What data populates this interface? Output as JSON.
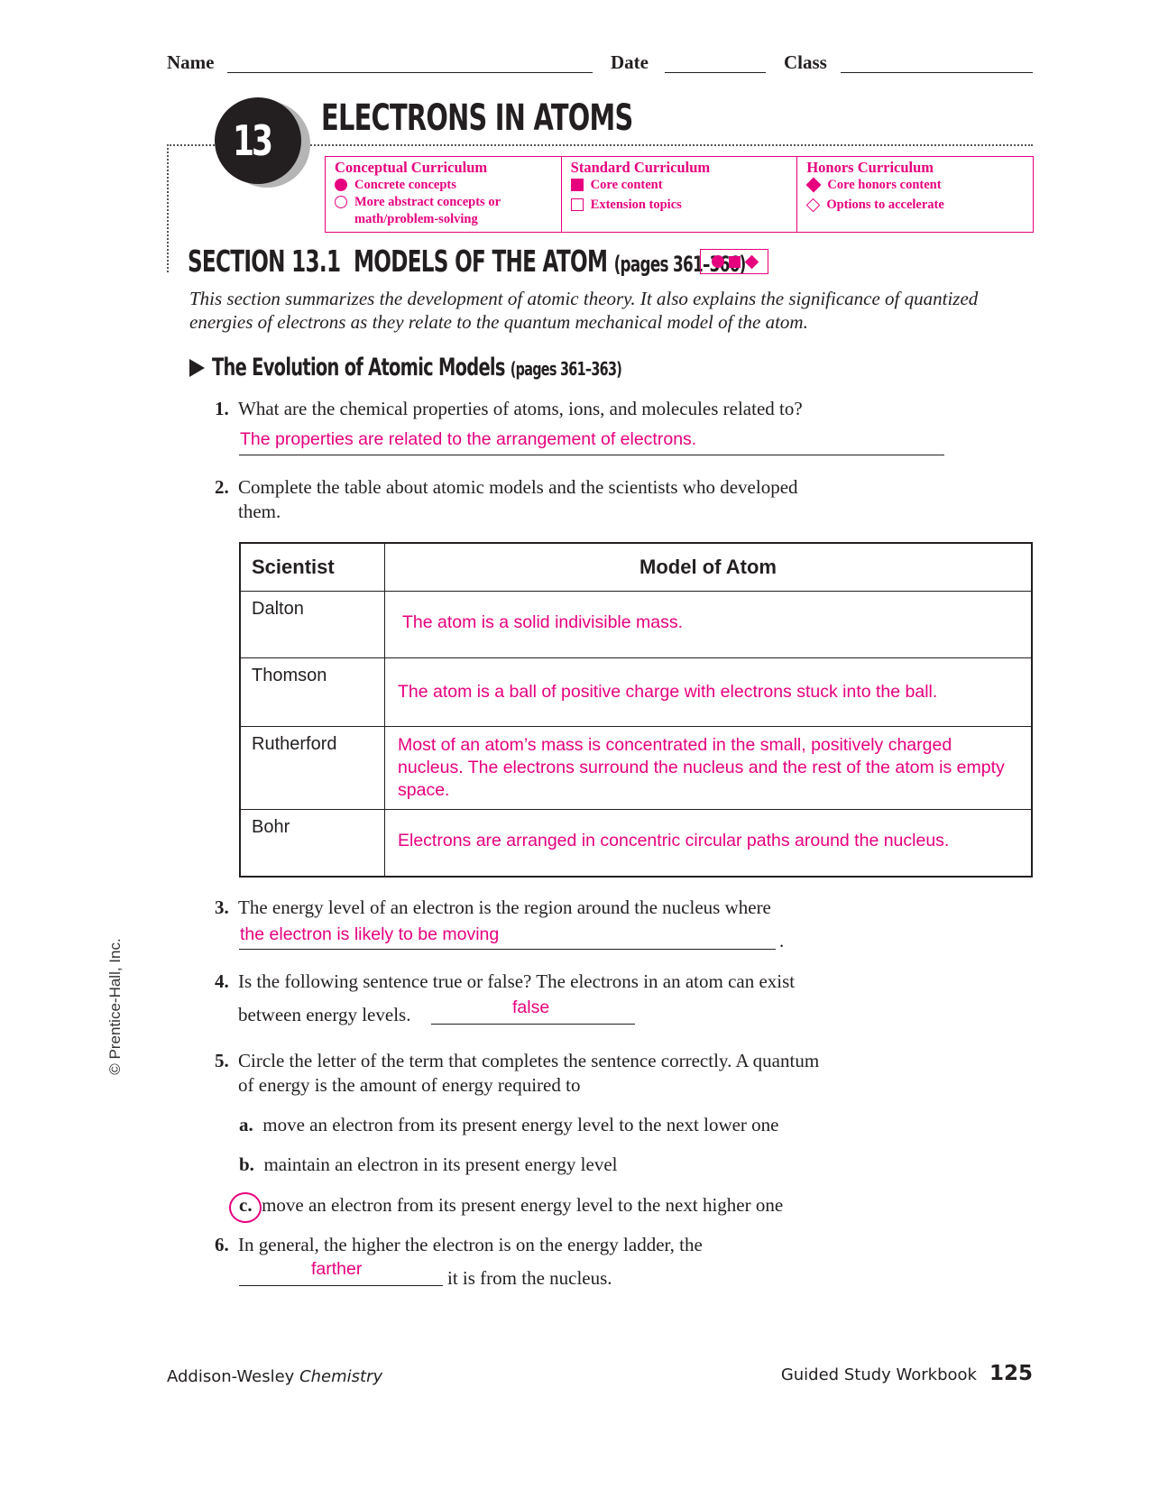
{
  "header": {
    "name_label": "Name",
    "date_label": "Date",
    "class_label": "Class"
  },
  "chapter": {
    "number": "13",
    "title": "ELECTRONS IN ATOMS"
  },
  "curriculum": [
    {
      "title": "Conceptual Curriculum",
      "items": [
        {
          "icon": "filled-circle-icon",
          "label": "Concrete concepts"
        },
        {
          "icon": "open-circle-icon",
          "label": "More abstract concepts or math/problem-solving"
        }
      ]
    },
    {
      "title": "Standard Curriculum",
      "items": [
        {
          "icon": "filled-square-icon",
          "label": "Core content"
        },
        {
          "icon": "open-square-icon",
          "label": "Extension topics"
        }
      ]
    },
    {
      "title": "Honors Curriculum",
      "items": [
        {
          "icon": "filled-diamond-icon",
          "label": "Core honors content"
        },
        {
          "icon": "open-diamond-icon",
          "label": "Options to accelerate"
        }
      ]
    }
  ],
  "section": {
    "title": "SECTION 13.1  MODELS OF THE ATOM",
    "pages": "(pages 361–366)",
    "intro": "This section summarizes the development of atomic theory. It also explains the significance of quantized energies of electrons as they relate to the quantum mechanical model of the atom."
  },
  "subsection": {
    "title": "The Evolution of Atomic Models",
    "pages": "(pages 361–363)"
  },
  "questions": {
    "q1": {
      "num": "1.",
      "text": "What are the chemical properties of atoms, ions, and molecules related to?",
      "answer": "The properties are related to the arrangement of electrons."
    },
    "q2": {
      "num": "2.",
      "text_line1": "Complete the table about atomic models and the scientists who developed",
      "text_line2": "them."
    },
    "q3": {
      "num": "3.",
      "text": "The energy level of an electron is the region around the nucleus where",
      "answer": "the electron is likely to be moving",
      "end": "."
    },
    "q4": {
      "num": "4.",
      "text_line1": "Is the following sentence true or false? The electrons in an atom can exist",
      "text_line2": "between energy levels.",
      "answer": "false"
    },
    "q5": {
      "num": "5.",
      "text_line1": "Circle the letter of the term that completes the sentence correctly. A quantum",
      "text_line2": "of energy is the amount of energy required to",
      "options": [
        {
          "letter": "a.",
          "text": "move an electron from its present energy level to the next lower one",
          "circled": false
        },
        {
          "letter": "b.",
          "text": "maintain an electron in its present energy level",
          "circled": false
        },
        {
          "letter": "c.",
          "text": "move an electron from its present energy level to the next higher one",
          "circled": true
        }
      ]
    },
    "q6": {
      "num": "6.",
      "text_line1": "In general, the higher the electron is on the energy ladder, the",
      "answer": "farther",
      "text_end": "it is from the nucleus."
    }
  },
  "table": {
    "headers": [
      "Scientist",
      "Model of Atom"
    ],
    "rows": [
      {
        "scientist": "Dalton",
        "model": "The atom is a solid indivisible mass."
      },
      {
        "scientist": "Thomson",
        "model": "The atom is a ball of positive charge with electrons stuck into the ball."
      },
      {
        "scientist": "Rutherford",
        "model": "Most of an atom’s mass is concentrated in the small, positively charged nucleus. The electrons surround the nucleus and the rest of the atom is empty space."
      },
      {
        "scientist": "Bohr",
        "model": "Electrons are arranged in concentric circular paths around the nucleus."
      }
    ]
  },
  "footer": {
    "publisher": "Addison-Wesley",
    "book": "Chemistry",
    "workbook": "Guided Study Workbook",
    "page": "125"
  },
  "copyright": "© Prentice-Hall, Inc.",
  "colors": {
    "accent": "#e6007e",
    "text": "#231f20"
  }
}
